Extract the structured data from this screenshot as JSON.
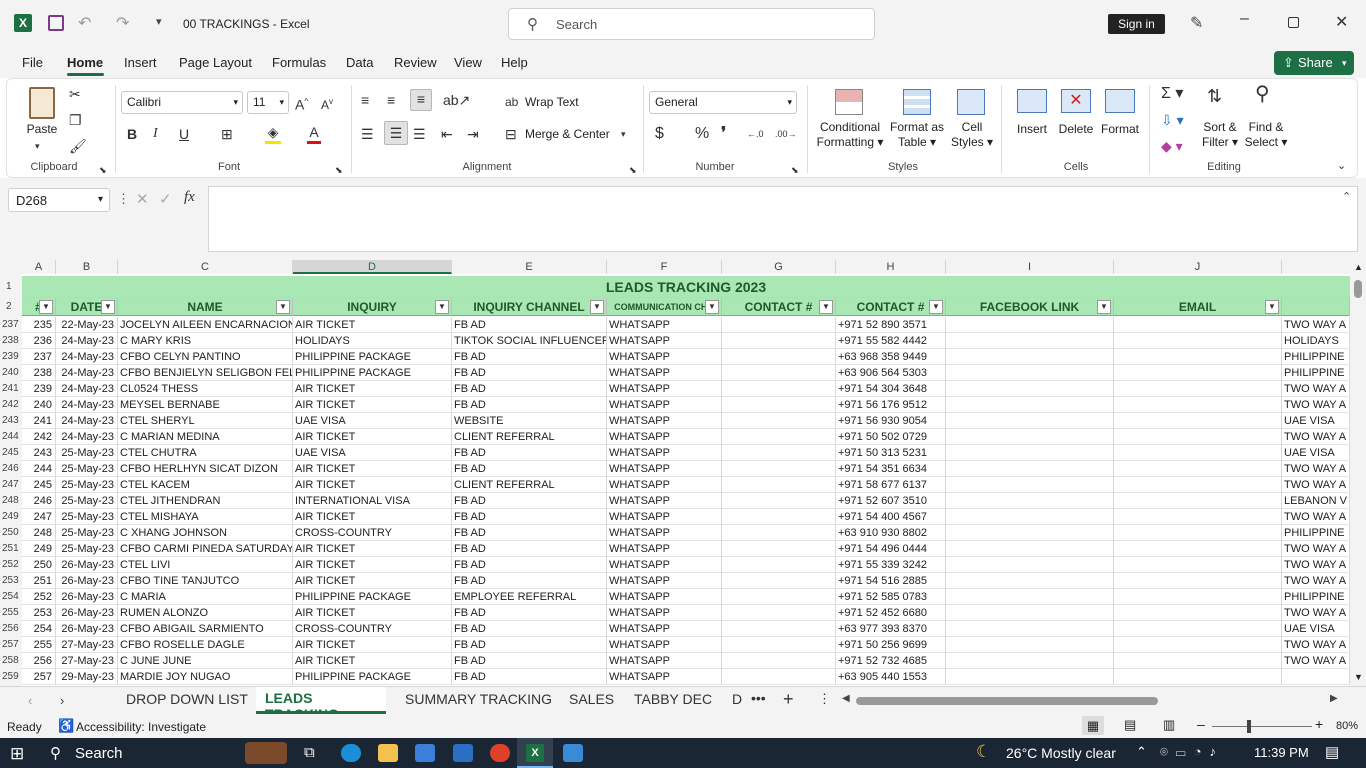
{
  "app": {
    "title": "00 TRACKINGS  -  Excel",
    "search_placeholder": "Search",
    "sign_in": "Sign in"
  },
  "menu": {
    "items": [
      "File",
      "Home",
      "Insert",
      "Page Layout",
      "Formulas",
      "Data",
      "Review",
      "View",
      "Help"
    ],
    "share": "Share"
  },
  "ribbon": {
    "clipboard": {
      "paste": "Paste",
      "group": "Clipboard"
    },
    "font": {
      "name": "Calibri",
      "size": "11",
      "group": "Font"
    },
    "alignment": {
      "wrap": "Wrap Text",
      "merge": "Merge & Center",
      "group": "Alignment"
    },
    "number": {
      "format": "General",
      "group": "Number"
    },
    "styles": {
      "conditional1": "Conditional",
      "conditional2": "Formatting",
      "format_table1": "Format as",
      "format_table2": "Table",
      "cell_styles1": "Cell",
      "cell_styles2": "Styles",
      "group": "Styles"
    },
    "cells": {
      "insert": "Insert",
      "delete": "Delete",
      "format": "Format",
      "group": "Cells"
    },
    "editing": {
      "sort1": "Sort &",
      "sort2": "Filter",
      "find1": "Find &",
      "find2": "Select",
      "group": "Editing"
    }
  },
  "formula_bar": {
    "name_box": "D268",
    "fx": "fx",
    "value": ""
  },
  "sheet": {
    "columns": [
      "A",
      "B",
      "C",
      "D",
      "E",
      "F",
      "G",
      "H",
      "I",
      "J"
    ],
    "title_row_number": "1",
    "header_row_number": "2",
    "title": "LEADS TRACKING 2023",
    "headers": [
      "#",
      "DATE",
      "NAME",
      "INQUIRY",
      "INQUIRY CHANNEL",
      "COMMUNICATION CHA",
      "CONTACT #",
      "CONTACT #",
      "FACEBOOK LINK",
      "EMAIL",
      ""
    ],
    "rows": [
      {
        "r": "237",
        "a": "235",
        "b": "22-May-23",
        "c": "JOCELYN AILEEN ENCARNACION",
        "d": "AIR TICKET",
        "e": "FB AD",
        "f": "WHATSAPP",
        "h": "+971 52 890 3571",
        "k": "TWO WAY A"
      },
      {
        "r": "238",
        "a": "236",
        "b": "24-May-23",
        "c": "C MARY KRIS",
        "d": "HOLIDAYS",
        "e": "TIKTOK SOCIAL INFLUENCER/ A",
        "f": "WHATSAPP",
        "h": "+971 55 582 4442",
        "k": "HOLIDAYS"
      },
      {
        "r": "239",
        "a": "237",
        "b": "24-May-23",
        "c": "CFBO CELYN PANTINO",
        "d": "PHILIPPINE PACKAGE",
        "e": "FB AD",
        "f": "WHATSAPP",
        "h": "+63 968 358 9449",
        "k": "PHILIPPINE"
      },
      {
        "r": "240",
        "a": "238",
        "b": "24-May-23",
        "c": "CFBO BENJIELYN SELIGBON FELICI",
        "d": "PHILIPPINE PACKAGE",
        "e": "FB AD",
        "f": "WHATSAPP",
        "h": "+63 906 564 5303",
        "k": "PHILIPPINE"
      },
      {
        "r": "241",
        "a": "239",
        "b": "24-May-23",
        "c": "CL0524 THESS",
        "d": "AIR TICKET",
        "e": "FB AD",
        "f": "WHATSAPP",
        "h": "+971 54 304 3648",
        "k": "TWO WAY A"
      },
      {
        "r": "242",
        "a": "240",
        "b": "24-May-23",
        "c": "MEYSEL BERNABE",
        "d": "AIR TICKET",
        "e": "FB AD",
        "f": "WHATSAPP",
        "h": "+971 56 176 9512",
        "k": "TWO WAY A"
      },
      {
        "r": "243",
        "a": "241",
        "b": "24-May-23",
        "c": "CTEL SHERYL",
        "d": "UAE VISA",
        "e": "WEBSITE",
        "f": "WHATSAPP",
        "h": "+971 56 930 9054",
        "k": "UAE VISA"
      },
      {
        "r": "244",
        "a": "242",
        "b": "24-May-23",
        "c": "C MARIAN MEDINA",
        "d": "AIR TICKET",
        "e": "CLIENT REFERRAL",
        "f": "WHATSAPP",
        "h": "+971 50 502 0729",
        "k": "TWO WAY A"
      },
      {
        "r": "245",
        "a": "243",
        "b": "25-May-23",
        "c": "CTEL CHUTRA",
        "d": "UAE VISA",
        "e": "FB AD",
        "f": "WHATSAPP",
        "h": "+971 50 313 5231",
        "k": "UAE VISA"
      },
      {
        "r": "246",
        "a": "244",
        "b": "25-May-23",
        "c": "CFBO HERLHYN SICAT DIZON",
        "d": "AIR TICKET",
        "e": "FB AD",
        "f": "WHATSAPP",
        "h": "+971 54 351 6634",
        "k": "TWO WAY A"
      },
      {
        "r": "247",
        "a": "245",
        "b": "25-May-23",
        "c": "CTEL KACEM",
        "d": "AIR TICKET",
        "e": "CLIENT REFERRAL",
        "f": "WHATSAPP",
        "h": "+971 58 677 6137",
        "k": "TWO WAY A"
      },
      {
        "r": "248",
        "a": "246",
        "b": "25-May-23",
        "c": "CTEL JITHENDRAN",
        "d": "INTERNATIONAL VISA",
        "e": "FB AD",
        "f": "WHATSAPP",
        "h": "+971 52 607 3510",
        "k": "LEBANON V"
      },
      {
        "r": "249",
        "a": "247",
        "b": "25-May-23",
        "c": "CTEL MISHAYA",
        "d": "AIR TICKET",
        "e": "FB AD",
        "f": "WHATSAPP",
        "h": "+971 54 400 4567",
        "k": "TWO WAY A"
      },
      {
        "r": "250",
        "a": "248",
        "b": "25-May-23",
        "c": "C XHANG JOHNSON",
        "d": "CROSS-COUNTRY",
        "e": "FB AD",
        "f": "WHATSAPP",
        "h": "+63 910 930 8802",
        "k": "PHILIPPINE"
      },
      {
        "r": "251",
        "a": "249",
        "b": "25-May-23",
        "c": "CFBO CARMI PINEDA SATURDAY",
        "d": "AIR TICKET",
        "e": "FB AD",
        "f": "WHATSAPP",
        "h": "+971 54 496 0444",
        "k": "TWO WAY A"
      },
      {
        "r": "252",
        "a": "250",
        "b": "26-May-23",
        "c": "CTEL LIVI",
        "d": "AIR TICKET",
        "e": "FB AD",
        "f": "WHATSAPP",
        "h": "+971 55 339 3242",
        "k": "TWO WAY A"
      },
      {
        "r": "253",
        "a": "251",
        "b": "26-May-23",
        "c": "CFBO TINE TANJUTCO",
        "d": "AIR TICKET",
        "e": "FB AD",
        "f": "WHATSAPP",
        "h": "+971 54 516 2885",
        "k": "TWO WAY A"
      },
      {
        "r": "254",
        "a": "252",
        "b": "26-May-23",
        "c": "C MARIA",
        "d": "PHILIPPINE PACKAGE",
        "e": "EMPLOYEE REFERRAL",
        "f": "WHATSAPP",
        "h": "+971 52 585 0783",
        "k": "PHILIPPINE"
      },
      {
        "r": "255",
        "a": "253",
        "b": "26-May-23",
        "c": "RUMEN ALONZO",
        "d": "AIR TICKET",
        "e": "FB AD",
        "f": "WHATSAPP",
        "h": "+971 52 452 6680",
        "k": "TWO WAY A"
      },
      {
        "r": "256",
        "a": "254",
        "b": "26-May-23",
        "c": "CFBO ABIGAIL SARMIENTO",
        "d": "CROSS-COUNTRY",
        "e": "FB AD",
        "f": "WHATSAPP",
        "h": "+63 977 393 8370",
        "k": "UAE VISA"
      },
      {
        "r": "257",
        "a": "255",
        "b": "27-May-23",
        "c": "CFBO ROSELLE DAGLE",
        "d": "AIR TICKET",
        "e": "FB AD",
        "f": "WHATSAPP",
        "h": "+971 50 256 9699",
        "k": "TWO WAY A"
      },
      {
        "r": "258",
        "a": "256",
        "b": "27-May-23",
        "c": "C JUNE JUNE",
        "d": "AIR TICKET",
        "e": "FB AD",
        "f": "WHATSAPP",
        "h": "+971 52 732 4685",
        "k": "TWO WAY A"
      },
      {
        "r": "259",
        "a": "257",
        "b": "29-May-23",
        "c": "MARDIE JOY NUGAO",
        "d": "PHILIPPINE PACKAGE",
        "e": "FB AD",
        "f": "WHATSAPP",
        "h": "+63 905 440 1553",
        "k": ""
      }
    ]
  },
  "sheet_tabs": [
    "DROP DOWN LIST",
    "LEADS TRACKING",
    "SUMMARY TRACKING",
    "SALES",
    "TABBY DEC",
    "D"
  ],
  "status": {
    "ready": "Ready",
    "accessibility": "Accessibility: Investigate",
    "zoom": "80%"
  },
  "taskbar": {
    "search": "Search",
    "weather": "26°C  Mostly clear",
    "time": "11:39 PM"
  }
}
